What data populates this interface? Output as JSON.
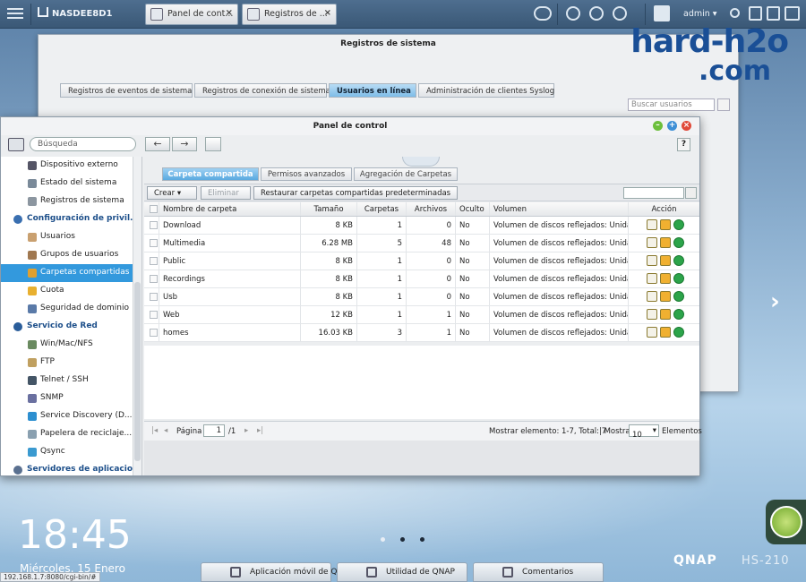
{
  "taskbar": {
    "nas_name": "NASDEE8D1",
    "tabs": [
      "Panel de cont...",
      "Registros de ..."
    ],
    "user": "admin"
  },
  "watermark": {
    "line1": "hard-h2o",
    "line2": ".com"
  },
  "back_window": {
    "title": "Registros de sistema",
    "tabs": [
      "Registros de eventos de sistema",
      "Registros de conexión de sistema",
      "Usuarios en línea",
      "Administración de clientes Syslog"
    ],
    "search_placeholder": "Buscar usuarios"
  },
  "window": {
    "title": "Panel de control",
    "help": "?",
    "search_placeholder": "Búsqueda"
  },
  "sidebar": {
    "items": [
      {
        "type": "item",
        "label": "Dispositivo externo"
      },
      {
        "type": "item",
        "label": "Estado del sistema"
      },
      {
        "type": "item",
        "label": "Registros de sistema"
      },
      {
        "type": "group",
        "label": "Configuración de privil..."
      },
      {
        "type": "item",
        "label": "Usuarios"
      },
      {
        "type": "item",
        "label": "Grupos de usuarios"
      },
      {
        "type": "item",
        "label": "Carpetas compartidas"
      },
      {
        "type": "item",
        "label": "Cuota"
      },
      {
        "type": "item",
        "label": "Seguridad de dominio"
      },
      {
        "type": "group",
        "label": "Servicio de Red"
      },
      {
        "type": "item",
        "label": "Win/Mac/NFS"
      },
      {
        "type": "item",
        "label": "FTP"
      },
      {
        "type": "item",
        "label": "Telnet / SSH"
      },
      {
        "type": "item",
        "label": "SNMP"
      },
      {
        "type": "item",
        "label": "Service Discovery (D..."
      },
      {
        "type": "item",
        "label": "Papelera de reciclaje..."
      },
      {
        "type": "item",
        "label": "Qsync"
      },
      {
        "type": "group",
        "label": "Servidores de aplicacio..."
      }
    ]
  },
  "content": {
    "tabs": [
      "Carpeta compartida",
      "Permisos avanzados",
      "Agregación de Carpetas"
    ],
    "buttons": {
      "create": "Crear",
      "delete": "Eliminar",
      "restore": "Restaurar carpetas compartidas predeterminadas"
    },
    "columns": [
      "Nombre de carpeta",
      "Tamaño",
      "Carpetas",
      "Archivos",
      "Oculto",
      "Volumen",
      "Acción"
    ],
    "rows": [
      {
        "name": "Download",
        "size": "8 KB",
        "folders": "1",
        "files": "0",
        "hidden": "No",
        "volume": "Volumen de discos reflejados: Unida..."
      },
      {
        "name": "Multimedia",
        "size": "6.28 MB",
        "folders": "5",
        "files": "48",
        "hidden": "No",
        "volume": "Volumen de discos reflejados: Unida..."
      },
      {
        "name": "Public",
        "size": "8 KB",
        "folders": "1",
        "files": "0",
        "hidden": "No",
        "volume": "Volumen de discos reflejados: Unida..."
      },
      {
        "name": "Recordings",
        "size": "8 KB",
        "folders": "1",
        "files": "0",
        "hidden": "No",
        "volume": "Volumen de discos reflejados: Unida..."
      },
      {
        "name": "Usb",
        "size": "8 KB",
        "folders": "1",
        "files": "0",
        "hidden": "No",
        "volume": "Volumen de discos reflejados: Unida..."
      },
      {
        "name": "Web",
        "size": "12 KB",
        "folders": "1",
        "files": "1",
        "hidden": "No",
        "volume": "Volumen de discos reflejados: Unida..."
      },
      {
        "name": "homes",
        "size": "16.03 KB",
        "folders": "3",
        "files": "1",
        "hidden": "No",
        "volume": "Volumen de discos reflejados: Unida..."
      }
    ],
    "pager": {
      "page_label": "Página",
      "page": "1",
      "of": "/1",
      "showing": "Mostrar elemento: 1-7, Total: 7",
      "show_label": "| Mostrar",
      "per_page": "10",
      "items_label": "Elementos"
    }
  },
  "desktop": {
    "time": "18:45",
    "date": "Miércoles, 15 Enero",
    "brand": "QNAP",
    "model": "HS-210",
    "status_url": "192.168.1.7:8080/cgi-bin/#",
    "dock": [
      "Aplicación móvil de QNAP",
      "Utilidad de QNAP",
      "Comentarios"
    ]
  }
}
